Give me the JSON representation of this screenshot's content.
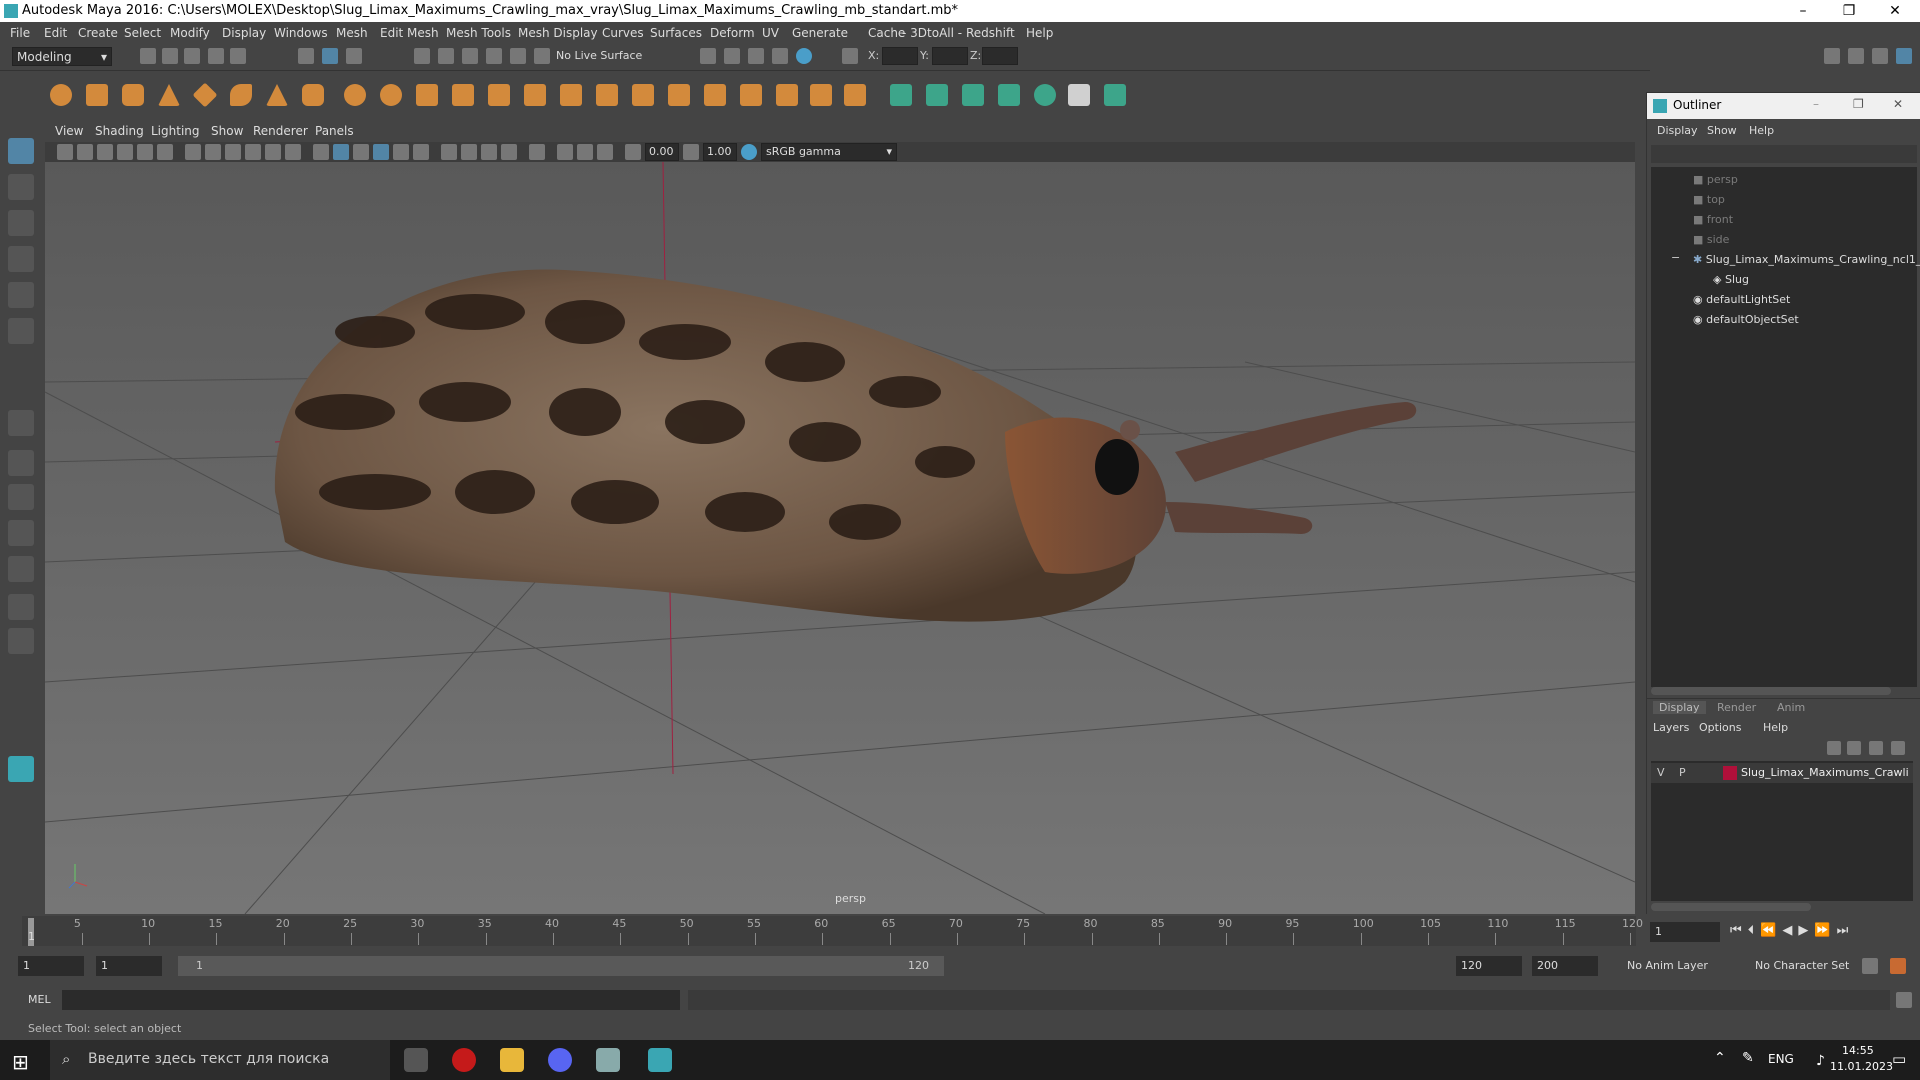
{
  "window": {
    "title": "Autodesk Maya 2016: C:\\Users\\MOLEX\\Desktop\\Slug_Limax_Maximums_Crawling_max_vray\\Slug_Limax_Maximums_Crawling_mb_standart.mb*",
    "minimize": "–",
    "restore": "❐",
    "close": "✕"
  },
  "menubar": [
    "File",
    "Edit",
    "Create",
    "Select",
    "Modify",
    "Display",
    "Windows",
    "Mesh",
    "Edit Mesh",
    "Mesh Tools",
    "Mesh Display",
    "Curves",
    "Surfaces",
    "Deform",
    "UV",
    "Generate",
    "Cache",
    "- 3DtoAll -",
    "Redshift",
    "Help"
  ],
  "statusline": {
    "mode": "Modeling",
    "live_surface": "No Live Surface",
    "x_label": "X:",
    "y_label": "Y:",
    "z_label": "Z:"
  },
  "viewport": {
    "menu": [
      "View",
      "Shading",
      "Lighting",
      "Show",
      "Renderer",
      "Panels"
    ],
    "field_a": "0.00",
    "field_b": "1.00",
    "color_space": "sRGB gamma",
    "camera_label": "persp"
  },
  "outliner": {
    "title": "Outliner",
    "menu": [
      "Display",
      "Show",
      "Help"
    ],
    "items": [
      {
        "label": "persp",
        "dim": true
      },
      {
        "label": "top",
        "dim": true
      },
      {
        "label": "front",
        "dim": true
      },
      {
        "label": "side",
        "dim": true
      },
      {
        "label": "Slug_Limax_Maximums_Crawling_ncl1_",
        "dim": false
      },
      {
        "label": "Slug",
        "dim": false
      },
      {
        "label": "defaultLightSet",
        "dim": false
      },
      {
        "label": "defaultObjectSet",
        "dim": false
      }
    ],
    "collapse_glyph": "−"
  },
  "layers": {
    "tabs": [
      "Display",
      "Render",
      "Anim"
    ],
    "menu": [
      "Layers",
      "Options",
      "Help"
    ],
    "row": {
      "v": "V",
      "p": "P",
      "name": "Slug_Limax_Maximums_Crawli",
      "color": "#b0103a"
    }
  },
  "timeline": {
    "ticks": [
      "5",
      "10",
      "15",
      "20",
      "25",
      "30",
      "35",
      "40",
      "45",
      "50",
      "55",
      "60",
      "65",
      "70",
      "75",
      "80",
      "85",
      "90",
      "95",
      "100",
      "105",
      "110",
      "115",
      "120"
    ],
    "current_marker": "1",
    "current_frame": "1"
  },
  "range": {
    "start": "1",
    "playback_start": "1",
    "slider_start": "1",
    "slider_end": "120",
    "playback_end": "120",
    "end": "200",
    "anim_layer": "No Anim Layer",
    "character_set": "No Character Set"
  },
  "command": {
    "label": "MEL"
  },
  "help_line": "Select Tool: select an object",
  "taskbar": {
    "search_placeholder": "Введите здесь текст для поиска",
    "lang": "ENG",
    "time": "14:55",
    "date": "11.01.2023"
  },
  "colors": {
    "accent": "#5285a6",
    "layer_color": "#b0103a",
    "maya_teal": "#3aa6b3"
  }
}
